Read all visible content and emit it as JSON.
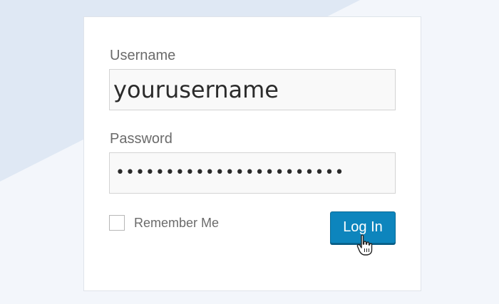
{
  "login_form": {
    "username_label": "Username",
    "username_value": "yourusername",
    "password_label": "Password",
    "password_value": "•••••••••••••••••••••••",
    "remember_label": "Remember Me",
    "remember_checked": false,
    "login_button_label": "Log In"
  },
  "colors": {
    "page_background": "#f3f6fb",
    "background_band": "#dfe8f4",
    "button": "#0d85bd",
    "button_text": "#ffffff"
  },
  "icons": {
    "cursor": "hand-pointer-icon"
  }
}
